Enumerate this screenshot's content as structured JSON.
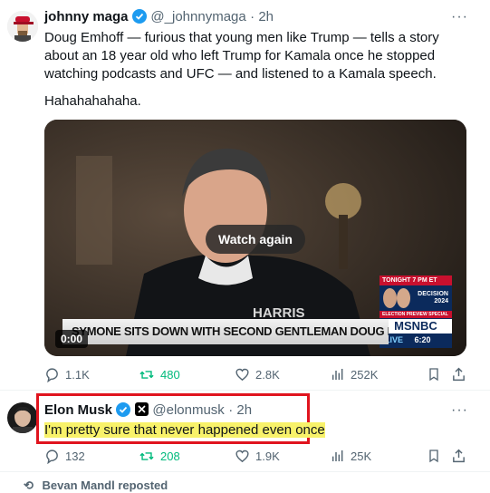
{
  "tweet1": {
    "name": "johnny maga",
    "handle": "@_johnnymaga",
    "time": "· 2h",
    "text1": "Doug Emhoff — furious that young men like Trump — tells a story about an 18 year old who left Trump for Kamala once he stopped watching podcasts and UFC — and listened to a Kamala speech.",
    "text2": "Hahahahahaha.",
    "media": {
      "watch_again": "Watch again",
      "time": "0:00",
      "banner": "SYMONE SITS DOWN WITH SECOND GENTLEMAN DOUG EMHOFF",
      "shirt_text": "HARRIS",
      "tonight": "TONIGHT 7 PM ET",
      "election_preview": "ELECTION PREVIEW SPECIAL",
      "decision": "DECISION 2024",
      "network": "MSNBC",
      "live": "LIVE",
      "live_time": "6:20"
    },
    "metrics": {
      "replies": "1.1K",
      "reposts": "480",
      "likes": "2.8K",
      "views": "252K"
    }
  },
  "tweet2": {
    "name": "Elon Musk",
    "handle": "@elonmusk",
    "time": "· 2h",
    "text": "I'm pretty sure that never happened even once",
    "metrics": {
      "replies": "132",
      "reposts": "208",
      "likes": "1.9K",
      "views": "25K"
    }
  },
  "footer": {
    "partial_text": "Bevan Mandl reposted"
  },
  "colors": {
    "verified": "#1d9bf0",
    "repost_green": "#00ba7c",
    "highlight": "#f8f26a",
    "red_box": "#e0141e"
  }
}
